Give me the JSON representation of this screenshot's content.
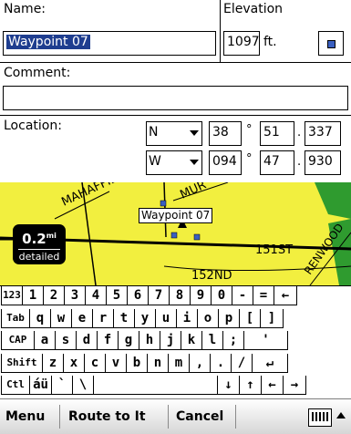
{
  "form": {
    "name_label": "Name:",
    "name_value": "Waypoint 07",
    "elevation_label": "Elevation",
    "elevation_value": "1097",
    "elevation_unit": "ft.",
    "comment_label": "Comment:",
    "comment_value": "",
    "location_label": "Location:",
    "lat_hemisphere": "N",
    "lat_deg": "38",
    "lat_min": "51",
    "lat_frac": "337",
    "lon_hemisphere": "W",
    "lon_deg": "094",
    "lon_min": "47",
    "lon_frac": "930",
    "degree_symbol": "°",
    "decimal_point": "."
  },
  "map": {
    "waypoint_label": "Waypoint 07",
    "scale_value": "0.2",
    "scale_unit": "mi",
    "zoom_mode": "detailed",
    "streets": [
      "MAHAFFIE",
      "MUR",
      "151ST",
      "152ND",
      "RENWOOD"
    ],
    "colors": {
      "land": "#f2ef3f",
      "road": "#000000",
      "park": "#2f9b2f",
      "label_bg": "#ffffff"
    }
  },
  "keyboard": {
    "rows": [
      [
        "123",
        "1",
        "2",
        "3",
        "4",
        "5",
        "6",
        "7",
        "8",
        "9",
        "0",
        "-",
        "=",
        "←"
      ],
      [
        "Tab",
        "q",
        "w",
        "e",
        "r",
        "t",
        "y",
        "u",
        "i",
        "o",
        "p",
        "[",
        "]"
      ],
      [
        "CAP",
        "a",
        "s",
        "d",
        "f",
        "g",
        "h",
        "j",
        "k",
        "l",
        ";",
        "'"
      ],
      [
        "Shift",
        "z",
        "x",
        "c",
        "v",
        "b",
        "n",
        "m",
        ",",
        ".",
        "/",
        "↵"
      ],
      [
        "Ctl",
        "áü",
        "`",
        "\\",
        " ",
        "↓",
        "↑",
        "←",
        "→"
      ]
    ]
  },
  "menubar": {
    "menu": "Menu",
    "route": "Route to It",
    "cancel": "Cancel",
    "keyboard_icon": "keyboard-icon"
  }
}
